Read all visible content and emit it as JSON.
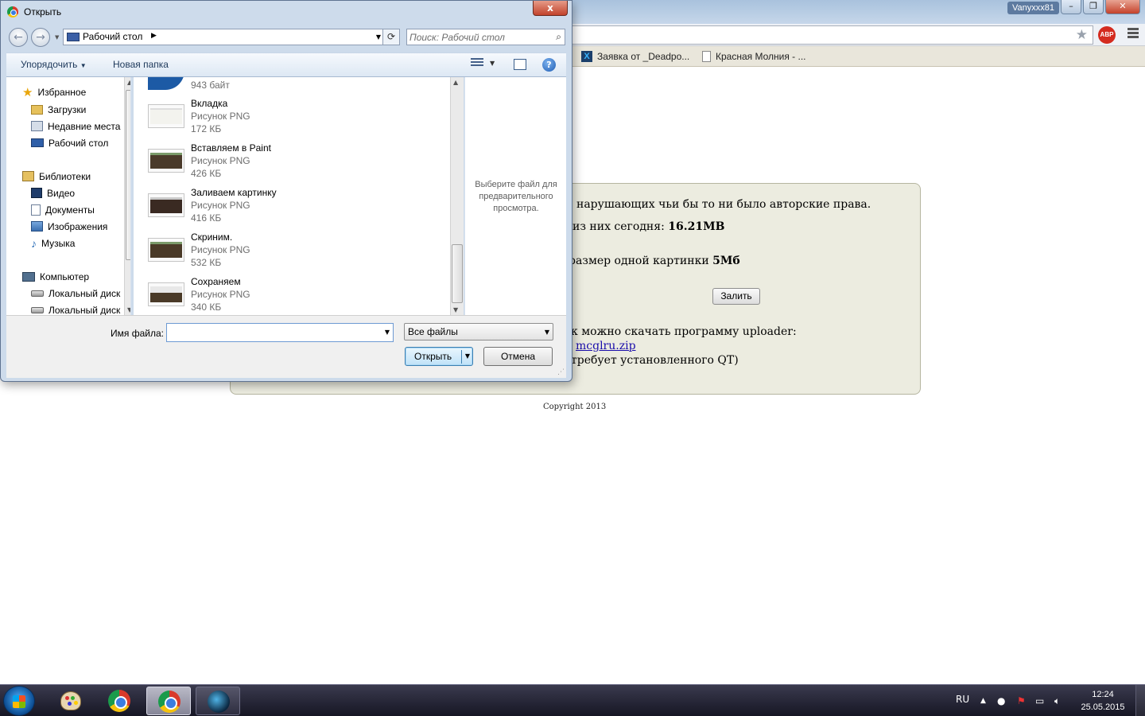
{
  "browser": {
    "profile_name": "Vanyxxx81",
    "bookmarks": [
      {
        "label": "Заявка от _Deadpo...",
        "icon": "x-site-icon"
      },
      {
        "label": "Красная Молния - ...",
        "icon": "page-icon"
      }
    ]
  },
  "page": {
    "lines": [
      "нарушающих чьи бы то ни было авторские права.",
      "из них сегодня: ",
      "размер одной картинки ",
      "к можно скачать программу uploader:",
      "mcglru.zip",
      "требует установленного QT)"
    ],
    "today_size": "16.21MB",
    "max_size": "5Мб",
    "upload_button": "Залить",
    "copyright": "Copyright 2013"
  },
  "dialog": {
    "title": "Открыть",
    "close_label": "x",
    "address": "Рабочий стол",
    "search_placeholder": "Поиск: Рабочий стол",
    "organize_label": "Упорядочить",
    "new_folder_label": "Новая папка",
    "nav": {
      "favorites": {
        "label": "Избранное",
        "items": [
          "Загрузки",
          "Недавние места",
          "Рабочий стол"
        ]
      },
      "libraries": {
        "label": "Библиотеки",
        "items": [
          "Видео",
          "Документы",
          "Изображения",
          "Музыка"
        ]
      },
      "computer": {
        "label": "Компьютер",
        "items": [
          "Локальный диск",
          "Локальный диск"
        ]
      }
    },
    "partial_file_size": "943 байт",
    "files": [
      {
        "name": "Вкладка",
        "type": "Рисунок PNG",
        "size": "172 КБ"
      },
      {
        "name": "Вставляем в Paint",
        "type": "Рисунок PNG",
        "size": "426 КБ"
      },
      {
        "name": "Заливаем картинку",
        "type": "Рисунок PNG",
        "size": "416 КБ"
      },
      {
        "name": "Скриним.",
        "type": "Рисунок PNG",
        "size": "532 КБ"
      },
      {
        "name": "Сохраняем",
        "type": "Рисунок PNG",
        "size": "340 КБ"
      }
    ],
    "preview_text": "Выберите файл для предварительного просмотра.",
    "filename_label": "Имя файла:",
    "filename_value": "",
    "filetype_value": "Все файлы",
    "open_label": "Открыть",
    "cancel_label": "Отмена"
  },
  "taskbar": {
    "language": "RU",
    "time": "12:24",
    "date": "25.05.2015"
  }
}
